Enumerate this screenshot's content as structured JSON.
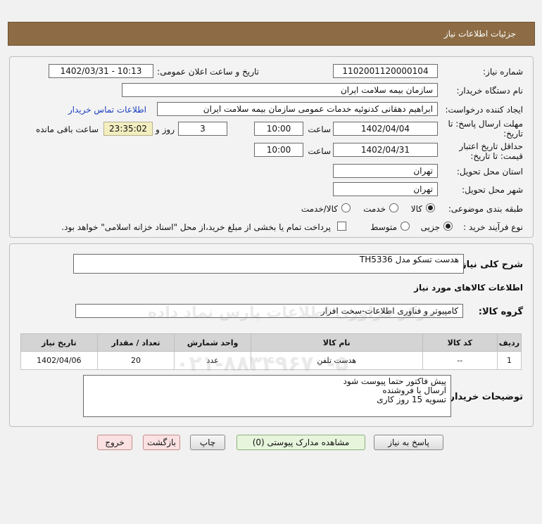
{
  "header": {
    "title": "جزئیات اطلاعات نیاز"
  },
  "form": {
    "need_number_label": "شماره نیاز:",
    "need_number": "1102001120000104",
    "announce_label": "تاریخ و ساعت اعلان عمومی:",
    "announce_value": "1402/03/31 - 10:13",
    "buyer_org_label": "نام دستگاه خریدار:",
    "buyer_org": "سازمان بیمه سلامت ایران",
    "creator_label": "ایجاد کننده درخواست:",
    "creator": "ابراهیم دهقانی کدنوئیه خدمات عمومی سازمان بیمه سلامت ایران",
    "contact_link": "اطلاعات تماس خریدار",
    "deadline_label_1": "مهلت ارسال پاسخ: تا",
    "deadline_label_2": "تاریخ:",
    "deadline_date": "1402/04/04",
    "time_label": "ساعت",
    "deadline_time": "10:00",
    "days": "3",
    "days_label": "روز و",
    "remaining_time": "23:35:02",
    "remaining_label": "ساعت باقی مانده",
    "validity_label_1": "حداقل تاریخ اعتبار",
    "validity_label_2": "قیمت: تا تاریخ:",
    "validity_date": "1402/04/31",
    "validity_time": "10:00",
    "province_label": "استان محل تحویل:",
    "province": "تهران",
    "city_label": "شهر محل تحویل:",
    "city": "تهران",
    "category_label": "طبقه بندی موضوعی:",
    "category_options": [
      "کالا",
      "خدمت",
      "کالا/خدمت"
    ],
    "category_selected": "کالا",
    "process_label": "نوع فرآیند خرید :",
    "process_options": [
      "جزیی",
      "متوسط"
    ],
    "process_selected": "جزیی",
    "payment_note": "پرداخت تمام یا بخشی از مبلغ خرید،از محل \"اسناد خزانه اسلامی\" خواهد بود."
  },
  "summary": {
    "description_label": "شرح کلی نیاز:",
    "description": "هدست تسکو مدل TH5336",
    "goods_info_title": "اطلاعات کالاهای مورد نیاز",
    "goods_group_label": "گروه کالا:",
    "goods_group": "کامپیوتر و فناوری اطلاعات-سخت افزار"
  },
  "table": {
    "headers": [
      "ردیف",
      "کد کالا",
      "نام کالا",
      "واحد شمارش",
      "تعداد / مقدار",
      "تاریخ نیاز"
    ],
    "rows": [
      [
        "1",
        "--",
        "هدست تلفن",
        "عدد",
        "20",
        "1402/04/06"
      ]
    ]
  },
  "buyer_notes": {
    "label": "توضیحات خریدار:",
    "lines": [
      "پیش فاکتور حتما پیوست شود",
      "ارسال با فروشنده",
      "تسویه 15 روز کاری"
    ]
  },
  "buttons": {
    "reply": "پاسخ به نیاز",
    "attachments": "مشاهده مدارک پیوستی (0)",
    "print": "چاپ",
    "back": "بازگشت",
    "exit": "خروج"
  },
  "colors": {
    "title_bar": "#8d6c45",
    "link": "#1a3fc2"
  }
}
